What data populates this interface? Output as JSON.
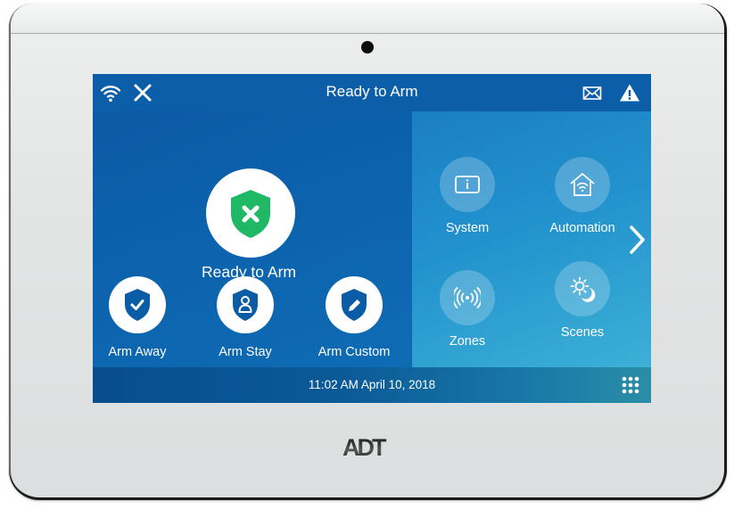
{
  "device": {
    "brand": "ADT"
  },
  "header": {
    "title": "Ready to Arm",
    "icons": {
      "wifi": "wifi-icon",
      "close": "close-icon",
      "message": "envelope-icon",
      "alert": "warning-icon"
    }
  },
  "status": {
    "label": "Ready to Arm",
    "icon": "shield-x-icon",
    "color": "#1fb865"
  },
  "arm_actions": [
    {
      "label": "Arm Away",
      "icon": "shield-check-icon"
    },
    {
      "label": "Arm Stay",
      "icon": "shield-person-icon"
    },
    {
      "label": "Arm Custom",
      "icon": "shield-pencil-icon"
    }
  ],
  "tiles": [
    {
      "label": "System",
      "icon": "info-panel-icon"
    },
    {
      "label": "Automation",
      "icon": "smart-home-icon"
    },
    {
      "label": "Zones",
      "icon": "sensor-waves-icon"
    },
    {
      "label": "Scenes",
      "icon": "sun-moon-icon"
    }
  ],
  "footer": {
    "datetime": "11:02 AM April 10, 2018",
    "keypad_icon": "keypad-icon"
  },
  "colors": {
    "header_bg": "#0d5ea9",
    "accent_blue": "#0b5ca7",
    "status_green": "#1fb865"
  }
}
